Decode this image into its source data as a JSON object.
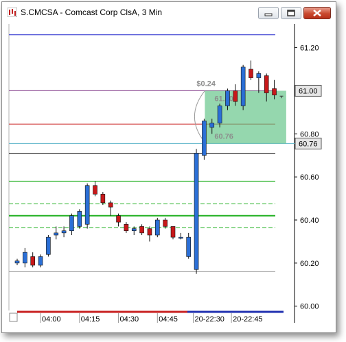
{
  "window": {
    "title": "S.CMCSA - Comcast Corp ClsA, 3 Min",
    "buttons": {
      "minimize": "minimize-icon",
      "maximize": "maximize-icon",
      "close": "close-icon"
    }
  },
  "chart_data": {
    "type": "candlestick",
    "title": "S.CMCSA - Comcast Corp ClsA, 3 Min",
    "xlabel": "",
    "ylabel": "",
    "ylim": [
      59.98,
      61.31
    ],
    "y_ticks": [
      "61.20",
      "61.00",
      "60.80",
      "60.60",
      "60.40",
      "60.20",
      "60.00"
    ],
    "x_ticks": [
      "04:00",
      "04:15",
      "04:30",
      "04:45",
      "20-22:30",
      "20-22:45"
    ],
    "price_labels": [
      {
        "text": "61.00",
        "value": 61.0,
        "bg": "#e6e6e6",
        "color": "#000000"
      },
      {
        "text": "60.76",
        "value": 60.755,
        "bg": "#e6e6e6",
        "color": "#000000"
      }
    ],
    "hlines": [
      {
        "value": 61.26,
        "color": "#1f22cc",
        "style": "solid"
      },
      {
        "value": 61.0,
        "color": "#7a2b80",
        "style": "solid"
      },
      {
        "value": 60.845,
        "color": "#cc2a2a",
        "style": "solid"
      },
      {
        "value": 60.755,
        "color": "#5ab3c8",
        "style": "solid"
      },
      {
        "value": 60.71,
        "color": "#000000",
        "style": "solid"
      },
      {
        "value": 60.58,
        "color": "#22b022",
        "style": "solid"
      },
      {
        "value": 60.475,
        "color": "#22b022",
        "style": "dashed"
      },
      {
        "value": 60.42,
        "color": "#22b022",
        "style": "solid-thick"
      },
      {
        "value": 60.365,
        "color": "#22b022",
        "style": "dashed"
      },
      {
        "value": 60.16,
        "color": "#999999",
        "style": "solid"
      }
    ],
    "trade_box": {
      "x_start": 24,
      "x_end": 34,
      "y_top": 61.0,
      "y_bottom": 60.755,
      "color": "#5cc183",
      "labels": [
        {
          "text": "$0.24",
          "value": 61.035
        },
        {
          "text": "61.00",
          "value": 60.965
        },
        {
          "text": "60.76",
          "value": 60.79
        }
      ]
    },
    "candles": [
      {
        "o": 60.2,
        "h": 60.22,
        "l": 60.19,
        "c": 60.21
      },
      {
        "o": 60.2,
        "h": 60.27,
        "l": 60.18,
        "c": 60.25
      },
      {
        "o": 60.23,
        "h": 60.25,
        "l": 60.18,
        "c": 60.19
      },
      {
        "o": 60.19,
        "h": 60.24,
        "l": 60.18,
        "c": 60.23
      },
      {
        "o": 60.24,
        "h": 60.33,
        "l": 60.23,
        "c": 60.32
      },
      {
        "o": 60.33,
        "h": 60.37,
        "l": 60.31,
        "c": 60.34
      },
      {
        "o": 60.34,
        "h": 60.37,
        "l": 60.32,
        "c": 60.35
      },
      {
        "o": 60.35,
        "h": 60.43,
        "l": 60.33,
        "c": 60.42
      },
      {
        "o": 60.37,
        "h": 60.45,
        "l": 60.36,
        "c": 60.44
      },
      {
        "o": 60.38,
        "h": 60.57,
        "l": 60.36,
        "c": 60.56
      },
      {
        "o": 60.56,
        "h": 60.58,
        "l": 60.51,
        "c": 60.52
      },
      {
        "o": 60.52,
        "h": 60.53,
        "l": 60.47,
        "c": 60.48
      },
      {
        "o": 60.48,
        "h": 60.49,
        "l": 60.42,
        "c": 60.46
      },
      {
        "o": 60.42,
        "h": 60.43,
        "l": 60.37,
        "c": 60.39
      },
      {
        "o": 60.38,
        "h": 60.39,
        "l": 60.34,
        "c": 60.35
      },
      {
        "o": 60.35,
        "h": 60.37,
        "l": 60.33,
        "c": 60.36
      },
      {
        "o": 60.37,
        "h": 60.38,
        "l": 60.33,
        "c": 60.34
      },
      {
        "o": 60.36,
        "h": 60.37,
        "l": 60.3,
        "c": 60.33
      },
      {
        "o": 60.33,
        "h": 60.41,
        "l": 60.32,
        "c": 60.4
      },
      {
        "o": 60.4,
        "h": 60.41,
        "l": 60.36,
        "c": 60.37
      },
      {
        "o": 60.37,
        "h": 60.37,
        "l": 60.31,
        "c": 60.32
      },
      {
        "o": 60.32,
        "h": 60.34,
        "l": 60.31,
        "c": 60.32
      },
      {
        "o": 60.23,
        "h": 60.34,
        "l": 60.22,
        "c": 60.32
      },
      {
        "o": 60.17,
        "h": 60.73,
        "l": 60.15,
        "c": 60.71
      },
      {
        "o": 60.7,
        "h": 60.87,
        "l": 60.68,
        "c": 60.86
      },
      {
        "o": 60.83,
        "h": 60.87,
        "l": 60.8,
        "c": 60.85
      },
      {
        "o": 60.85,
        "h": 60.94,
        "l": 60.83,
        "c": 60.93
      },
      {
        "o": 60.93,
        "h": 61.01,
        "l": 60.91,
        "c": 61.0
      },
      {
        "o": 61.0,
        "h": 61.03,
        "l": 60.93,
        "c": 60.95
      },
      {
        "o": 60.93,
        "h": 61.12,
        "l": 60.91,
        "c": 61.11
      },
      {
        "o": 61.1,
        "h": 61.14,
        "l": 61.05,
        "c": 61.06
      },
      {
        "o": 61.06,
        "h": 61.09,
        "l": 60.99,
        "c": 61.08
      },
      {
        "o": 61.07,
        "h": 61.08,
        "l": 60.95,
        "c": 60.99
      },
      {
        "o": 61.01,
        "h": 61.05,
        "l": 60.96,
        "c": 60.98
      }
    ]
  }
}
